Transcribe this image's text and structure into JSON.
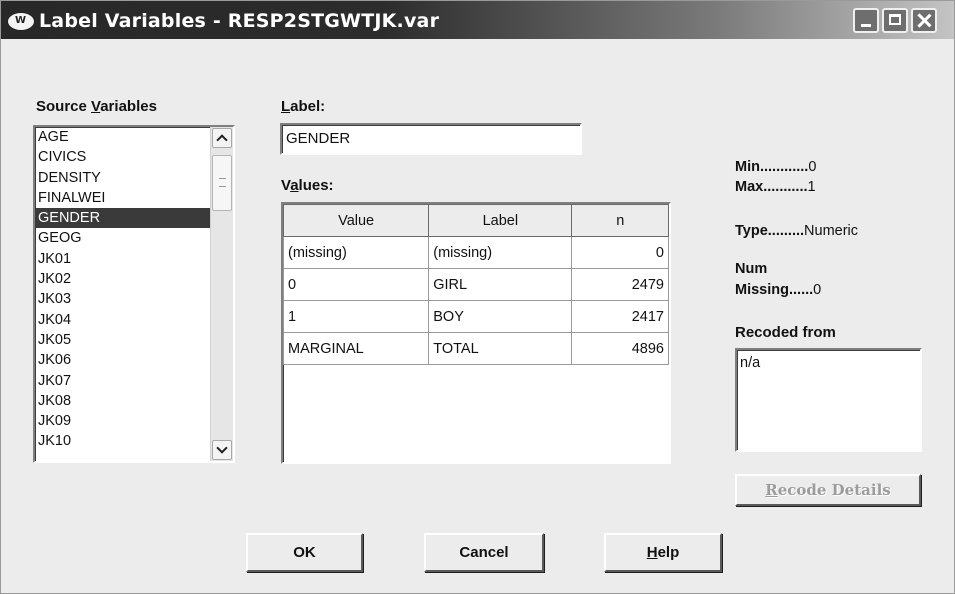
{
  "window": {
    "title": "Label Variables - RESP2STGWTJK.var"
  },
  "source_variables": {
    "label_pre": "Source ",
    "label_accel": "V",
    "label_post": "ariables",
    "items": [
      "AGE",
      "CIVICS",
      "DENSITY",
      "FINALWEI",
      "GENDER",
      "GEOG",
      "JK01",
      "JK02",
      "JK03",
      "JK04",
      "JK05",
      "JK06",
      "JK07",
      "JK08",
      "JK09",
      "JK10"
    ],
    "selected": "GENDER"
  },
  "label_field": {
    "caption_accel": "L",
    "caption_post": "abel:",
    "value": "GENDER"
  },
  "values_grid": {
    "caption_pre": "V",
    "caption_accel": "a",
    "caption_post": "lues:",
    "columns": [
      "Value",
      "Label",
      "n"
    ],
    "rows": [
      [
        "(missing)",
        "(missing)",
        "0"
      ],
      [
        "0",
        "GIRL",
        "2479"
      ],
      [
        "1",
        "BOY",
        "2417"
      ],
      [
        "MARGINAL",
        "TOTAL",
        "4896"
      ]
    ]
  },
  "stats": {
    "min_label": "Min............",
    "min_value": "0",
    "max_label": "Max...........",
    "max_value": "1",
    "type_label": "Type.........",
    "type_value": "Numeric",
    "num_label": "Num",
    "missing_label": "Missing......",
    "missing_value": "0",
    "recoded_label": "Recoded from",
    "recoded_value": "n/a"
  },
  "buttons": {
    "recode_accel": "R",
    "recode_post": "ecode Details",
    "ok": "OK",
    "cancel": "Cancel",
    "help_accel": "H",
    "help_post": "elp"
  }
}
